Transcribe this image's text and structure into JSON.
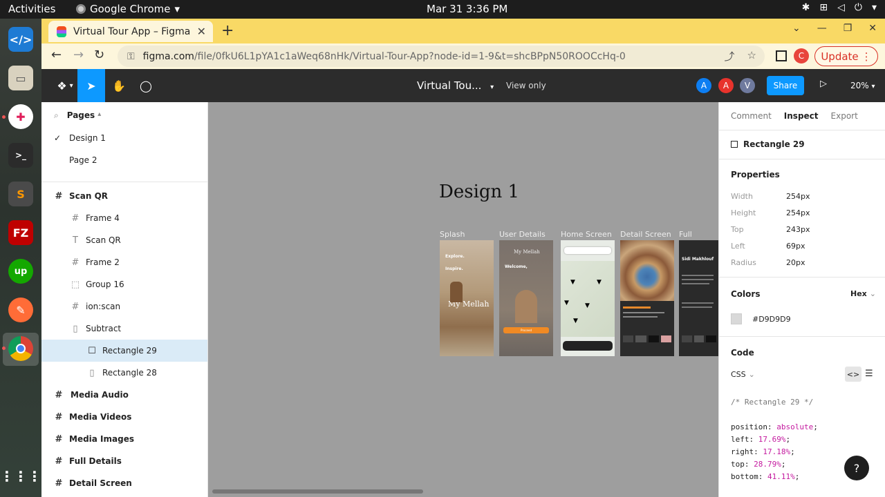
{
  "system": {
    "activities": "Activities",
    "app": "Google Chrome",
    "clock": "Mar 31  3:36 PM"
  },
  "browser": {
    "tab_title": "Virtual Tour App – Figma",
    "url_host": "figma.com",
    "url_path": "/file/0fkU6L1pYA1c1aWeq68nHk/Virtual-Tour-App?node-id=1-9&t=shcBPpN50ROOCcHq-0",
    "update_label": "Update",
    "profile_initial": "C"
  },
  "figma": {
    "file_title": "Virtual Tou...",
    "view_mode": "View only",
    "share_label": "Share",
    "zoom": "20%",
    "avatars": [
      {
        "letter": "A",
        "color": "#0d7ef2"
      },
      {
        "letter": "A",
        "color": "#e8332c"
      },
      {
        "letter": "V",
        "color": "#6f7a9e"
      }
    ]
  },
  "pages": {
    "heading": "Pages",
    "items": [
      "Design 1",
      "Page 2"
    ]
  },
  "layers": [
    {
      "label": "Scan QR",
      "icon": "#"
    },
    {
      "label": "Frame 4",
      "icon": "#"
    },
    {
      "label": "Scan QR",
      "icon": "T"
    },
    {
      "label": "Frame 2",
      "icon": "#"
    },
    {
      "label": "Group 16",
      "icon": "⬚"
    },
    {
      "label": "ion:scan",
      "icon": "#"
    },
    {
      "label": "Subtract",
      "icon": "▯"
    },
    {
      "label": "Rectangle 29",
      "icon": "☐"
    },
    {
      "label": "Rectangle 28",
      "icon": "▯"
    },
    {
      "label": "Media Audio",
      "icon": "#"
    },
    {
      "label": "Media Videos",
      "icon": "#"
    },
    {
      "label": "Media Images",
      "icon": "#"
    },
    {
      "label": "Full Details",
      "icon": "#"
    },
    {
      "label": "Detail Screen",
      "icon": "#"
    }
  ],
  "canvas": {
    "page_title": "Design 1",
    "frames": [
      "Splash",
      "User Details",
      "Home Screen",
      "Detail Screen",
      "Full Details"
    ],
    "splash": {
      "line1": "Explore.",
      "line2": "Inspire.",
      "brand": "My Mellah"
    },
    "user": {
      "brand": "My Mellah",
      "welcome": "Welcome,",
      "button": "Proceed"
    },
    "detail": {
      "name": "Sidi Makhlouf"
    }
  },
  "inspect": {
    "tabs": [
      "Comment",
      "Inspect",
      "Export"
    ],
    "selection": "Rectangle 29",
    "properties_heading": "Properties",
    "props": [
      {
        "k": "Width",
        "v": "254px"
      },
      {
        "k": "Height",
        "v": "254px"
      },
      {
        "k": "Top",
        "v": "243px"
      },
      {
        "k": "Left",
        "v": "69px"
      },
      {
        "k": "Radius",
        "v": "20px"
      }
    ],
    "colors_heading": "Colors",
    "color_format": "Hex",
    "color_value": "#D9D9D9",
    "code_heading": "Code",
    "code_lang": "CSS",
    "code_comment": "/* Rectangle 29 */",
    "css": [
      {
        "p": "position",
        "v": "absolute"
      },
      {
        "p": "left",
        "v": "17.69%"
      },
      {
        "p": "right",
        "v": "17.18%"
      },
      {
        "p": "top",
        "v": "28.79%"
      },
      {
        "p": "bottom",
        "v": "41.11%"
      }
    ]
  }
}
